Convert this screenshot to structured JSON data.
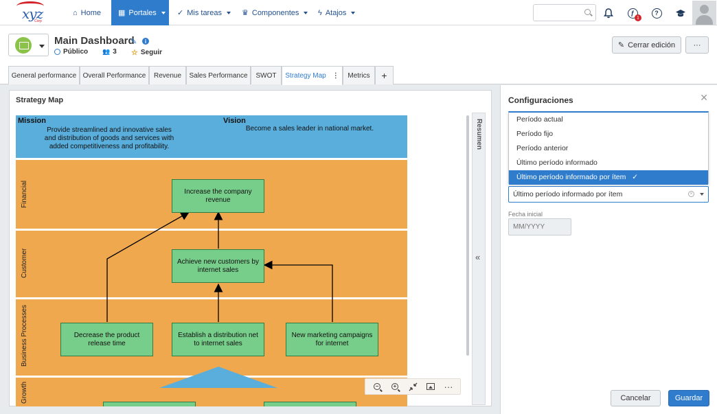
{
  "nav": {
    "logo_text": "xyz",
    "logo_sub": "Corp",
    "items": [
      {
        "label": "Home",
        "icon": "home-icon"
      },
      {
        "label": "Portales",
        "icon": "portal-icon"
      },
      {
        "label": "Mis tareas",
        "icon": "check-icon"
      },
      {
        "label": "Componentes",
        "icon": "trophy-icon"
      },
      {
        "label": "Atajos",
        "icon": "bolt-icon"
      }
    ],
    "search_placeholder": "",
    "notif_badge": "1"
  },
  "header": {
    "title": "Main Dashboard",
    "visibility": "Público",
    "members": "3",
    "follow": "Seguir",
    "edit_button": "Cerrar edición",
    "more_button": "···"
  },
  "tabs": [
    "General performance",
    "Overall Performance",
    "Revenue",
    "Sales Performance",
    "SWOT",
    "Strategy Map",
    "Metrics",
    "+"
  ],
  "active_tab": "Strategy Map",
  "strategy_map": {
    "title": "Strategy Map",
    "mission_title": "Mission",
    "mission_text": "Provide streamlined and innovative sales and distribution of goods and services with added competitiveness and profitability.",
    "vision_title": "Vision",
    "vision_text": "Become a sales leader in national market.",
    "lanes": [
      "Financial",
      "Customer",
      "Business Processes",
      "Growth"
    ],
    "nodes": {
      "revenue": "Increase the company revenue",
      "customers": "Achieve new customers by internet sales",
      "release": "Decrease the product release time",
      "distribution": "Establish a distribution net to internet sales",
      "marketing": "New marketing campaigns for internet"
    },
    "side_tab": "Resumen",
    "colors": {
      "mission": "#5aaedc",
      "lane": "#f0a84f",
      "node": "#77cd8a"
    }
  },
  "config": {
    "title": "Configuraciones",
    "options": [
      "Período actual",
      "Período fijo",
      "Período anterior",
      "Último período informado",
      "Último período informado por ítem"
    ],
    "selected": "Último período informado por ítem",
    "date_label": "Fecha inicial",
    "date_placeholder": "MM/YYYY",
    "cancel": "Cancelar",
    "save": "Guardar"
  }
}
